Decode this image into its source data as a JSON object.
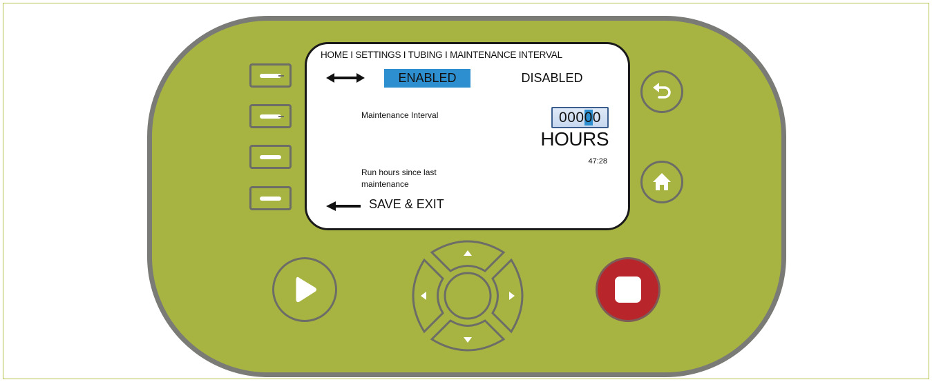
{
  "screen": {
    "breadcrumb": "HOME I SETTINGS I TUBING I MAINTENANCE INTERVAL",
    "option_enabled": "ENABLED",
    "option_disabled": "DISABLED",
    "maintenance_label": "Maintenance Interval",
    "counter_prefix": "000",
    "counter_cursor_digit": "0",
    "counter_suffix": "0",
    "unit": "HOURS",
    "run_hours": "47:28",
    "run_hours_label": "Run hours since last maintenance",
    "save_exit": "SAVE & EXIT"
  },
  "softkeys": [
    "softkey-1",
    "softkey-2",
    "softkey-3",
    "softkey-4"
  ],
  "buttons": {
    "back": "back-arrow-icon",
    "home": "home-icon",
    "play": "play-icon",
    "stop": "stop-icon",
    "dpad": [
      "up-arrow-icon",
      "down-arrow-icon",
      "left-arrow-icon",
      "right-arrow-icon"
    ]
  },
  "colors": {
    "device_body": "#a8b441",
    "device_border": "#7a7b76",
    "selection_blue": "#2e8fd0",
    "stop_red": "#b8262b"
  }
}
